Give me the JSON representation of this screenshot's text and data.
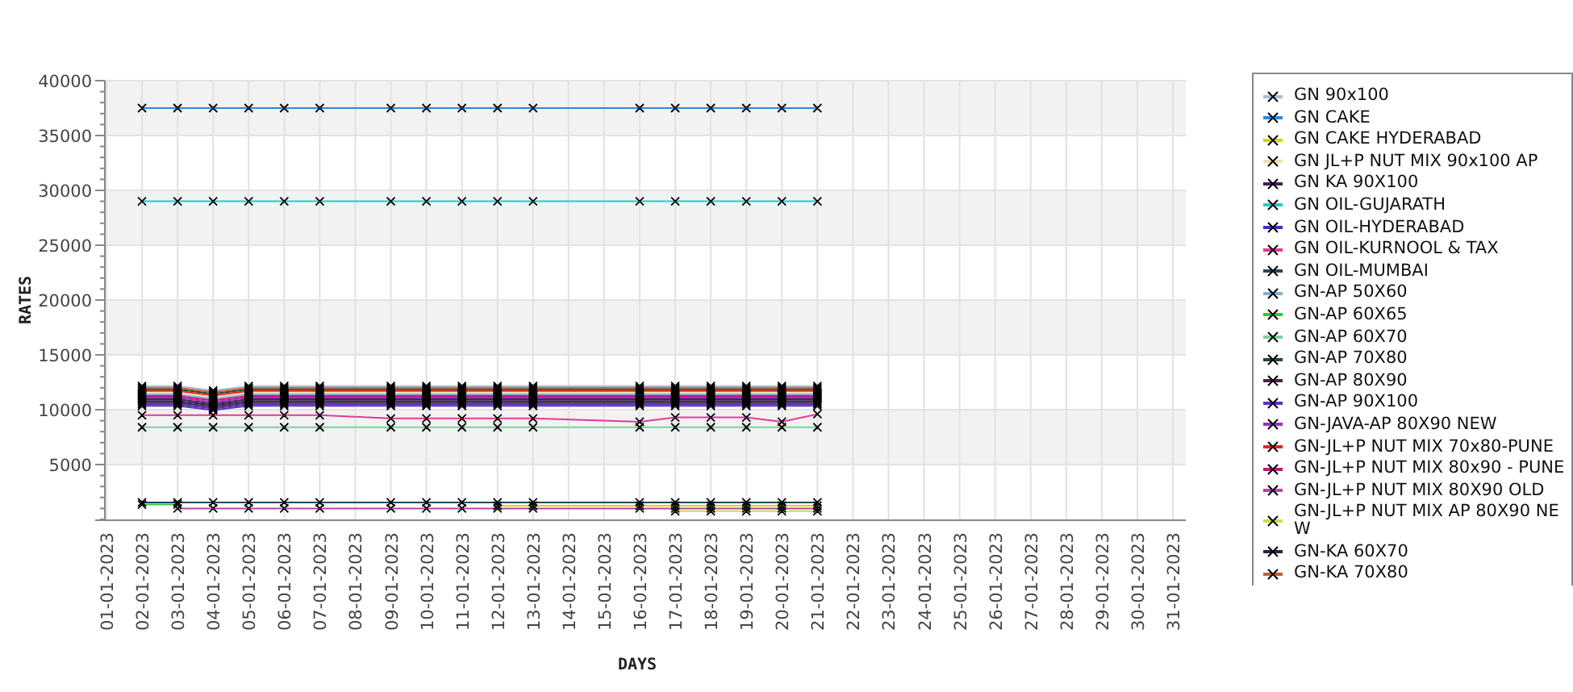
{
  "chart": {
    "chart_data": {
      "type": "line",
      "xlabel": "DAYS",
      "ylabel": "RATES",
      "grid": true,
      "categories": [
        "01-01-2023",
        "02-01-2023",
        "03-01-2023",
        "04-01-2023",
        "05-01-2023",
        "06-01-2023",
        "07-01-2023",
        "08-01-2023",
        "09-01-2023",
        "10-01-2023",
        "11-01-2023",
        "12-01-2023",
        "13-01-2023",
        "14-01-2023",
        "15-01-2023",
        "16-01-2023",
        "17-01-2023",
        "18-01-2023",
        "19-01-2023",
        "20-01-2023",
        "21-01-2023",
        "22-01-2023",
        "23-01-2023",
        "24-01-2023",
        "25-01-2023",
        "26-01-2023",
        "27-01-2023",
        "28-01-2023",
        "29-01-2023",
        "30-01-2023",
        "31-01-2023"
      ],
      "ylim": [
        0,
        40000
      ],
      "yticks": [
        5000,
        10000,
        15000,
        20000,
        25000,
        30000,
        35000,
        40000
      ],
      "series": [
        {
          "name": "GN 90x100",
          "color": "#a8bcd8",
          "marker": "x",
          "values": [
            null,
            12150,
            12150,
            11750,
            12150,
            12150,
            12150,
            null,
            12150,
            12150,
            12150,
            12150,
            12150,
            null,
            null,
            12150,
            12150,
            12150,
            12150,
            12150,
            12150,
            null,
            null,
            null,
            null,
            null,
            null,
            null,
            null,
            null,
            null
          ]
        },
        {
          "name": "GN CAKE",
          "color": "#2a8ae0",
          "marker": "x",
          "values": [
            null,
            37500,
            37500,
            37500,
            37500,
            37500,
            37500,
            null,
            37500,
            37500,
            37500,
            37500,
            37500,
            null,
            null,
            37500,
            37500,
            37500,
            37500,
            37500,
            37500,
            null,
            null,
            null,
            null,
            null,
            null,
            null,
            null,
            null,
            null
          ]
        },
        {
          "name": "GN CAKE HYDERABAD",
          "color": "#d4d400",
          "marker": "x",
          "values": [
            null,
            null,
            null,
            null,
            null,
            null,
            null,
            null,
            null,
            null,
            null,
            1250,
            1250,
            null,
            null,
            1250,
            1250,
            1250,
            1250,
            1250,
            1250,
            null,
            null,
            null,
            null,
            null,
            null,
            null,
            null,
            null,
            null
          ]
        },
        {
          "name": "GN JL+P NUT MIX 90x100 AP",
          "color": "#f0e0b0",
          "marker": "x",
          "values": [
            null,
            11550,
            11550,
            11150,
            11550,
            11550,
            11550,
            null,
            11550,
            11550,
            11550,
            11550,
            11550,
            null,
            null,
            11550,
            11550,
            11550,
            11550,
            11550,
            11550,
            null,
            null,
            null,
            null,
            null,
            null,
            null,
            null,
            null,
            null
          ]
        },
        {
          "name": "GN KA 90X100",
          "color": "#402060",
          "marker": "x",
          "values": [
            null,
            10950,
            10950,
            10550,
            10950,
            10950,
            10950,
            null,
            10950,
            10950,
            10950,
            10950,
            10950,
            null,
            null,
            10950,
            10950,
            10950,
            10950,
            10950,
            10950,
            null,
            null,
            null,
            null,
            null,
            null,
            null,
            null,
            null,
            null
          ]
        },
        {
          "name": "GN OIL-GUJARATH",
          "color": "#20d0c8",
          "marker": "x",
          "values": [
            null,
            29000,
            29000,
            29000,
            29000,
            29000,
            29000,
            null,
            29000,
            29000,
            29000,
            29000,
            29000,
            null,
            null,
            29000,
            29000,
            29000,
            29000,
            29000,
            29000,
            null,
            null,
            null,
            null,
            null,
            null,
            null,
            null,
            null,
            null
          ]
        },
        {
          "name": "GN OIL-HYDERABAD",
          "color": "#4030c0",
          "marker": "x",
          "values": [
            null,
            10500,
            10500,
            10100,
            10500,
            10500,
            10500,
            null,
            10500,
            10500,
            10500,
            10500,
            10500,
            null,
            null,
            10500,
            10500,
            10500,
            10500,
            10500,
            10500,
            null,
            null,
            null,
            null,
            null,
            null,
            null,
            null,
            null,
            null
          ]
        },
        {
          "name": "GN OIL-KURNOOL & TAX",
          "color": "#e83898",
          "marker": "x",
          "values": [
            null,
            9500,
            9500,
            9500,
            9500,
            9500,
            9500,
            null,
            9200,
            9200,
            9200,
            9200,
            9200,
            null,
            null,
            8900,
            9300,
            9300,
            9300,
            8900,
            9600,
            null,
            null,
            null,
            null,
            null,
            null,
            null,
            null,
            null,
            null
          ]
        },
        {
          "name": "GN OIL-MUMBAI",
          "color": "#204860",
          "marker": "x",
          "values": [
            null,
            1550,
            1550,
            1550,
            1550,
            1550,
            1550,
            null,
            1550,
            1550,
            1550,
            1550,
            1550,
            null,
            null,
            1550,
            1550,
            1550,
            1550,
            1550,
            1550,
            null,
            null,
            null,
            null,
            null,
            null,
            null,
            null,
            null,
            null
          ]
        },
        {
          "name": "GN-AP 50X60",
          "color": "#88aed0",
          "marker": "x",
          "values": [
            null,
            11400,
            11400,
            11000,
            11400,
            11400,
            11400,
            null,
            11400,
            11400,
            11400,
            11400,
            11400,
            null,
            null,
            11400,
            11400,
            11400,
            11400,
            11400,
            11400,
            null,
            null,
            null,
            null,
            null,
            null,
            null,
            null,
            null,
            null
          ]
        },
        {
          "name": "GN-AP 60X65",
          "color": "#30c840",
          "marker": "x",
          "values": [
            null,
            1350,
            1350,
            null,
            null,
            null,
            null,
            null,
            null,
            null,
            null,
            null,
            null,
            null,
            null,
            null,
            null,
            null,
            null,
            null,
            null,
            null,
            null,
            null,
            null,
            null,
            null,
            null,
            null,
            null,
            null
          ]
        },
        {
          "name": "GN-AP 60X70",
          "color": "#80d098",
          "marker": "x",
          "values": [
            null,
            8400,
            8400,
            8400,
            8400,
            8400,
            8400,
            null,
            8400,
            8400,
            8400,
            8400,
            8400,
            null,
            null,
            8400,
            8400,
            8400,
            8400,
            8400,
            8400,
            null,
            null,
            null,
            null,
            null,
            null,
            null,
            null,
            null,
            null
          ]
        },
        {
          "name": "GN-AP 70X80",
          "color": "#204838",
          "marker": "x",
          "values": [
            null,
            11850,
            11850,
            11450,
            11850,
            11850,
            11850,
            null,
            11850,
            11850,
            11850,
            11850,
            11850,
            null,
            null,
            11850,
            11850,
            11850,
            11850,
            11850,
            11850,
            null,
            null,
            null,
            null,
            null,
            null,
            null,
            null,
            null,
            null
          ]
        },
        {
          "name": "GN-AP 80X90",
          "color": "#502050",
          "marker": "x",
          "values": [
            null,
            10650,
            10650,
            10250,
            10650,
            10650,
            10650,
            null,
            10650,
            10650,
            10650,
            10650,
            10650,
            null,
            null,
            10650,
            10650,
            10650,
            10650,
            10650,
            10650,
            null,
            null,
            null,
            null,
            null,
            null,
            null,
            null,
            null,
            null
          ]
        },
        {
          "name": "GN-AP 90X100",
          "color": "#6030c0",
          "marker": "x",
          "values": [
            null,
            10350,
            10350,
            9950,
            10350,
            10350,
            10350,
            null,
            10350,
            10350,
            10350,
            10350,
            10350,
            null,
            null,
            10350,
            10350,
            10350,
            10350,
            10350,
            10350,
            null,
            null,
            null,
            null,
            null,
            null,
            null,
            null,
            null,
            null
          ]
        },
        {
          "name": "GN-JAVA-AP 80X90 NEW",
          "color": "#a030c0",
          "marker": "x",
          "values": [
            null,
            11100,
            11100,
            10700,
            11100,
            11100,
            11100,
            null,
            11100,
            11100,
            11100,
            11100,
            11100,
            null,
            null,
            11100,
            11100,
            11100,
            11100,
            11100,
            11100,
            null,
            null,
            null,
            null,
            null,
            null,
            null,
            null,
            null,
            null
          ]
        },
        {
          "name": "GN-JL+P NUT MIX 70x80-PUNE",
          "color": "#f02020",
          "marker": "x",
          "values": [
            null,
            11700,
            11700,
            11300,
            11700,
            11700,
            11700,
            null,
            11700,
            11700,
            11700,
            11700,
            11700,
            null,
            null,
            11700,
            11700,
            11700,
            11700,
            11700,
            11700,
            null,
            null,
            null,
            null,
            null,
            null,
            null,
            null,
            null,
            null
          ]
        },
        {
          "name": "GN-JL+P NUT MIX 80x90 - PUNE",
          "color": "#c01880",
          "marker": "x",
          "values": [
            null,
            11250,
            11250,
            10850,
            11250,
            11250,
            11250,
            null,
            11250,
            11250,
            11250,
            11250,
            11250,
            null,
            null,
            11250,
            11250,
            11250,
            11250,
            11250,
            11250,
            null,
            null,
            null,
            null,
            null,
            null,
            null,
            null,
            null,
            null
          ]
        },
        {
          "name": "GN-JL+P NUT MIX 80X90 OLD",
          "color": "#c040b0",
          "marker": "x",
          "values": [
            null,
            null,
            1000,
            1000,
            1000,
            1000,
            1000,
            null,
            1000,
            1000,
            1000,
            1000,
            1000,
            null,
            null,
            1000,
            1000,
            1000,
            1000,
            1000,
            1000,
            null,
            null,
            null,
            null,
            null,
            null,
            null,
            null,
            null,
            null
          ]
        },
        {
          "name": "GN-JL+P NUT MIX AP 80X90 NEW",
          "color": "#c8e040",
          "marker": "x",
          "values": [
            null,
            null,
            null,
            null,
            null,
            null,
            null,
            null,
            null,
            null,
            null,
            null,
            null,
            null,
            null,
            null,
            750,
            750,
            750,
            750,
            750,
            null,
            null,
            null,
            null,
            null,
            null,
            null,
            null,
            null,
            null
          ]
        },
        {
          "name": "GN-KA 60X70",
          "color": "#302040",
          "marker": "x",
          "values": [
            null,
            10800,
            10800,
            10400,
            10800,
            10800,
            10800,
            null,
            10800,
            10800,
            10800,
            10800,
            10800,
            null,
            null,
            10800,
            10800,
            10800,
            10800,
            10800,
            10800,
            null,
            null,
            null,
            null,
            null,
            null,
            null,
            null,
            null,
            null
          ]
        },
        {
          "name": "GN-KA 70X80",
          "color": "#c06040",
          "marker": "x",
          "values": [
            null,
            12000,
            12000,
            11600,
            12000,
            12000,
            12000,
            null,
            12000,
            12000,
            12000,
            12000,
            12000,
            null,
            null,
            12000,
            12000,
            12000,
            12000,
            12000,
            12000,
            null,
            null,
            null,
            null,
            null,
            null,
            null,
            null,
            null,
            null
          ]
        }
      ]
    }
  }
}
